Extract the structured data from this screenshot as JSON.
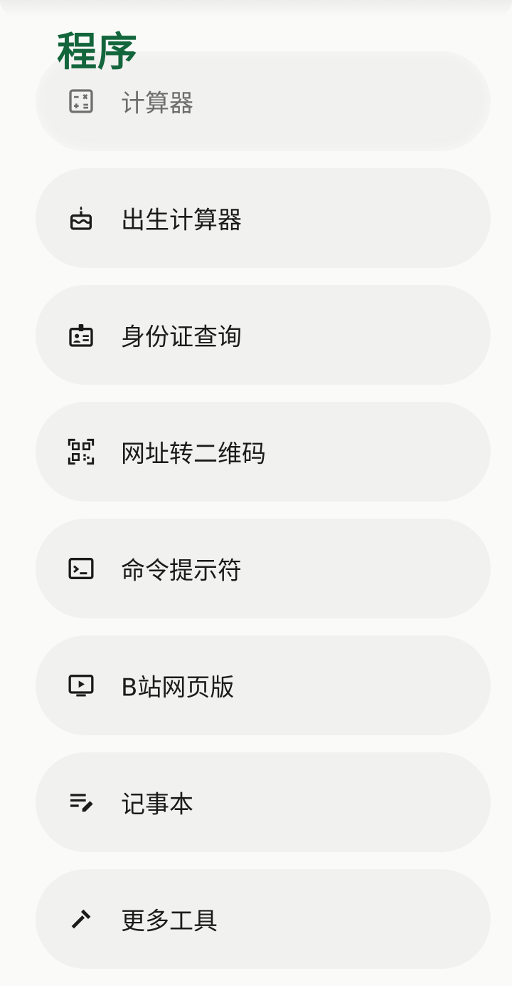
{
  "header": {
    "title": "程序"
  },
  "colors": {
    "accent": "#13663c",
    "item_bg": "#f1f1ef",
    "text": "#1b1c1a",
    "page_bg": "#fafbf8"
  },
  "items": [
    {
      "label": "计算器",
      "icon": "calculator-icon"
    },
    {
      "label": "出生计算器",
      "icon": "cake-icon"
    },
    {
      "label": "身份证查询",
      "icon": "id-badge-icon"
    },
    {
      "label": "网址转二维码",
      "icon": "qr-code-icon"
    },
    {
      "label": "命令提示符",
      "icon": "terminal-icon"
    },
    {
      "label": "B站网页版",
      "icon": "tv-play-icon"
    },
    {
      "label": "记事本",
      "icon": "notes-edit-icon"
    },
    {
      "label": "更多工具",
      "icon": "tools-icon"
    }
  ]
}
